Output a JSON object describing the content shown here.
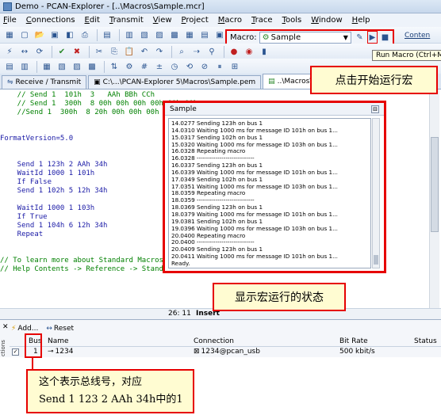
{
  "window": {
    "title": "Demo - PCAN-Explorer - [..\\Macros\\Sample.mcr]"
  },
  "menu": [
    "File",
    "Connections",
    "Edit",
    "Transmit",
    "View",
    "Project",
    "Macro",
    "Trace",
    "Tools",
    "Window",
    "Help"
  ],
  "macro_toolbar": {
    "label": "Macro:",
    "selected": "Sample",
    "connections_label": "Conten"
  },
  "tooltip": "Run Macro (Ctrl+M)",
  "tabs": [
    "Receive / Transmit",
    "C:\\...\\PCAN-Explorer 5\\Macros\\Sample.pem",
    "..\\Macros\\Sample.mcr"
  ],
  "code": [
    {
      "text": "    // Send 1  101h  3   AAh BBh CCh",
      "cls": "comment"
    },
    {
      "text": "    // Send 1  300h  8 00h 00h 00h 00h 00h 00h",
      "cls": "comment"
    },
    {
      "text": "    //Send 1  300h  8 20h 00h 00h 00h 00h 00h",
      "cls": "comment"
    },
    {
      "text": "",
      "cls": ""
    },
    {
      "text": "",
      "cls": ""
    },
    {
      "text": "FormatVersion=5.0",
      "cls": "kw"
    },
    {
      "text": "",
      "cls": ""
    },
    {
      "text": "",
      "cls": ""
    },
    {
      "text": "    Send 1 123h 2 AAh 34h",
      "cls": "kw"
    },
    {
      "text": "    WaitId 1000 1 101h",
      "cls": "kw"
    },
    {
      "text": "    If False",
      "cls": "kw"
    },
    {
      "text": "    Send 1 102h 5 12h 34h",
      "cls": "kw"
    },
    {
      "text": "",
      "cls": ""
    },
    {
      "text": "    WaitId 1000 1 103h",
      "cls": "kw"
    },
    {
      "text": "    If True",
      "cls": "kw"
    },
    {
      "text": "    Send 1 104h 6 12h 34h",
      "cls": "kw"
    },
    {
      "text": "    Repeat",
      "cls": "kw"
    },
    {
      "text": "",
      "cls": ""
    },
    {
      "text": "",
      "cls": ""
    },
    {
      "text": "",
      "cls": ""
    },
    {
      "text": "// To learn more about Standard Macros, see",
      "cls": "comment"
    },
    {
      "text": "// Help Contents -> Reference -> Standard Mac",
      "cls": "comment"
    }
  ],
  "status": {
    "position": "26: 11",
    "mode": "Insert"
  },
  "popup": {
    "title": "Sample",
    "lines": [
      "14.0277  Sending 123h on bus 1",
      "14.0310  Waiting 1000 ms for message ID 101h on bus 1...",
      "15.0317  Sending 102h on bus 1",
      "15.0320  Waiting 1000 ms for message ID 103h on bus 1...",
      "16.0328  Repeating macro",
      "16.0328  ----------------------------",
      "16.0337  Sending 123h on bus 1",
      "16.0339  Waiting 1000 ms for message ID 101h on bus 1...",
      "17.0349  Sending 102h on bus 1",
      "17.0351  Waiting 1000 ms for message ID 103h on bus 1...",
      "18.0359  Repeating macro",
      "18.0359  ----------------------------",
      "18.0369  Sending 123h on bus 1",
      "18.0379  Waiting 1000 ms for message ID 101h on bus 1...",
      "19.0381  Sending 102h on bus 1",
      "19.0396  Waiting 1000 ms for message ID 103h on bus 1...",
      "20.0400  Repeating macro",
      "20.0400  ----------------------------",
      "20.0409  Sending 123h on bus 1",
      "20.0411  Waiting 1000 ms for message ID 101h on bus 1...",
      "Ready."
    ]
  },
  "annotations": {
    "run_macro": "点击开始运行宏",
    "macro_status": "显示宏运行的状态",
    "bus_note_line1": "这个表示总线号，对应",
    "bus_note_line2": "Send 1 123 2 AAh 34h中的1"
  },
  "connections_panel": {
    "side_label": "ctions",
    "add_label": "Add...",
    "reset_label": "Reset",
    "headers": {
      "bus": "Bus",
      "name": "Name",
      "connection": "Connection",
      "bitrate": "Bit Rate",
      "status": "Status"
    },
    "row": {
      "bus": "1",
      "name": "1234",
      "connection": "1234@pcan_usb",
      "bitrate": "500 kbit/s",
      "status": ""
    }
  }
}
